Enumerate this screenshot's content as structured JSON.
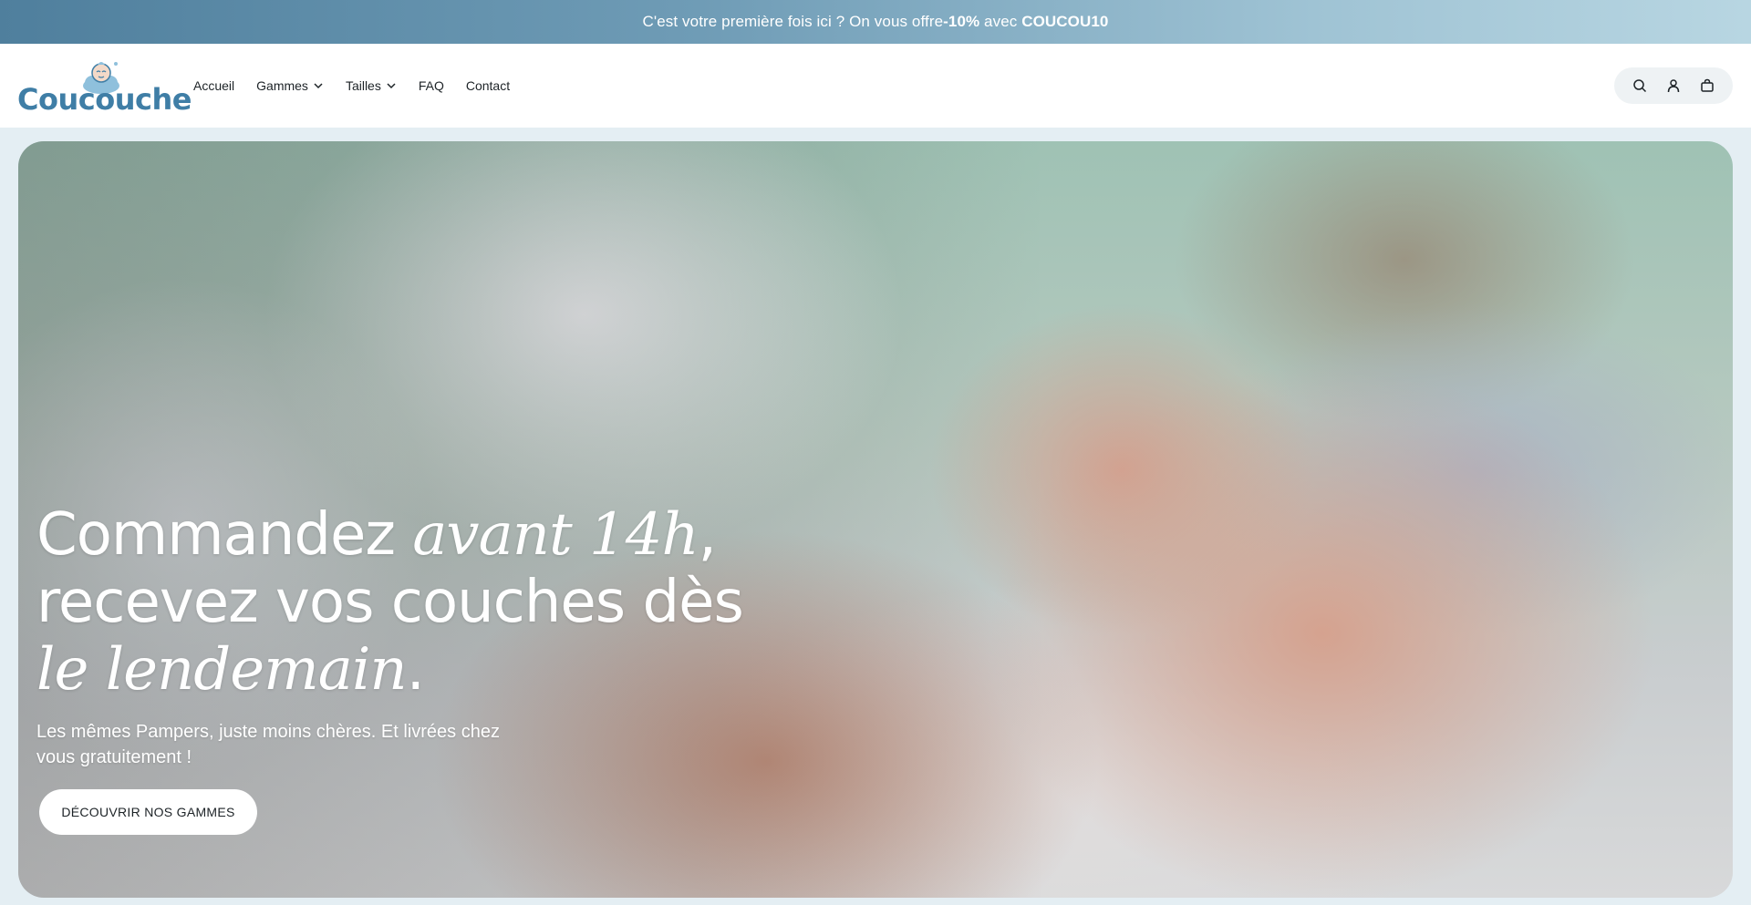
{
  "announcement": {
    "text_before": "C'est votre première fois ici ? On vous offre ",
    "discount": "-10%",
    "text_middle": " avec ",
    "code": "COUCOU10"
  },
  "header": {
    "logo_text": "Coucouche",
    "nav": [
      {
        "label": "Accueil",
        "has_dropdown": false
      },
      {
        "label": "Gammes",
        "has_dropdown": true
      },
      {
        "label": "Tailles",
        "has_dropdown": true
      },
      {
        "label": "FAQ",
        "has_dropdown": false
      },
      {
        "label": "Contact",
        "has_dropdown": false
      }
    ],
    "icons": [
      "search-icon",
      "account-icon",
      "cart-icon"
    ]
  },
  "hero": {
    "title_line1_plain": "Commandez ",
    "title_line1_italic": "avant 14h",
    "title_line1_end": ",",
    "title_line2": "recevez vos couches dès",
    "title_line3_italic": "le lendemain",
    "title_line3_end": ".",
    "subtitle": "Les mêmes Pampers, juste moins chères. Et livrées chez vous gratuitement !",
    "cta_label": "DÉCOUVRIR NOS GAMMES"
  },
  "colors": {
    "brand": "#3f7ea6",
    "announcement_start": "#4f7f9d",
    "announcement_end": "#b8d6e2"
  }
}
